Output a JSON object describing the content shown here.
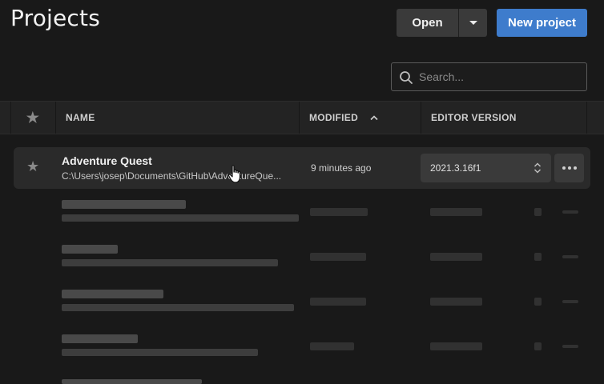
{
  "page": {
    "title": "Projects"
  },
  "toolbar": {
    "open_label": "Open",
    "new_project_label": "New project"
  },
  "search": {
    "placeholder": "Search...",
    "value": ""
  },
  "table": {
    "columns": {
      "star": "star-icon",
      "name": "NAME",
      "modified": "MODIFIED",
      "editor_version": "EDITOR VERSION"
    },
    "sort": {
      "column": "modified",
      "direction": "ascending"
    },
    "active_row": {
      "name": "Adventure Quest",
      "path": "C:\\Users\\josep\\Documents\\GitHub\\AdventureQue...",
      "modified": "9 minutes ago",
      "editor_version": "2021.3.16f1"
    },
    "blurred_rows_count": 5
  },
  "colors": {
    "accent": "#3e7ccc",
    "background": "#191919",
    "header_bg": "#232323",
    "row_highlight": "#2a2a2a"
  }
}
